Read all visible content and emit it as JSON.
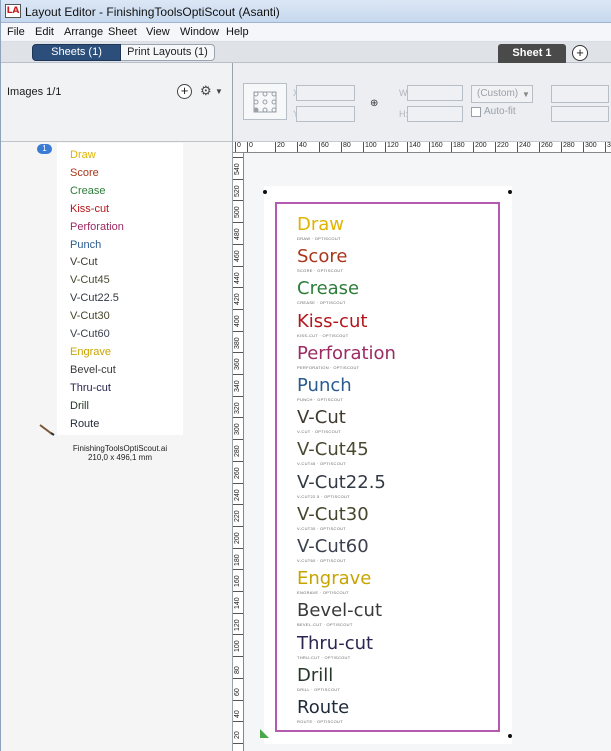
{
  "window": {
    "title": "Layout Editor - FinishingToolsOptiScout (Asanti)",
    "icon_label": "LA"
  },
  "menubar": {
    "items": [
      "File",
      "Edit",
      "Arrange",
      "Sheet",
      "View",
      "Window",
      "Help"
    ]
  },
  "tabs": {
    "sheets": "Sheets (1)",
    "print_layouts": "Print Layouts (1)",
    "sheet_tab": "Sheet 1"
  },
  "left_panel": {
    "images_count": "Images 1/1",
    "badge": "1",
    "file_name": "FinishingToolsOptiScout.ai",
    "file_size": "210,0 x 496,1 mm"
  },
  "toolbar": {
    "x_label": "X:",
    "y_label": "Y:",
    "w_label": "W:",
    "h_label": "H:",
    "preset": "(Custom)",
    "autofit": "Auto-fit"
  },
  "ruler": {
    "top": [
      "0",
      "0",
      "20",
      "40",
      "60",
      "80",
      "100",
      "120",
      "140",
      "160",
      "180",
      "200",
      "220",
      "240",
      "260",
      "280",
      "300",
      "320"
    ],
    "left": [
      "540",
      "520",
      "500",
      "480",
      "460",
      "440",
      "420",
      "400",
      "380",
      "360",
      "340",
      "320",
      "300",
      "280",
      "260",
      "240",
      "220",
      "200",
      "180",
      "160",
      "140",
      "120",
      "100",
      "80",
      "60",
      "40",
      "20",
      "0"
    ]
  },
  "tools": [
    {
      "label": "Draw",
      "color": "#e0b400",
      "sub": "DRAW  ·  OPTISCOUT"
    },
    {
      "label": "Score",
      "color": "#a8361a",
      "sub": "SCORE  ·  OPTISCOUT"
    },
    {
      "label": "Crease",
      "color": "#2e7d3a",
      "sub": "CREASE  ·  OPTISCOUT"
    },
    {
      "label": "Kiss-cut",
      "color": "#b3161b",
      "sub": "KISS-CUT  ·  OPTISCOUT"
    },
    {
      "label": "Perforation",
      "color": "#9c2a63",
      "sub": "PERFORATION  ·  OPTISCOUT"
    },
    {
      "label": "Punch",
      "color": "#2a5a8e",
      "sub": "PUNCH  ·  OPTISCOUT"
    },
    {
      "label": "V-Cut",
      "color": "#3e3a2f",
      "sub": "V-CUT  ·  OPTISCOUT"
    },
    {
      "label": "V-Cut45",
      "color": "#4a4a32",
      "sub": "V-CUT45  ·  OPTISCOUT"
    },
    {
      "label": "V-Cut22.5",
      "color": "#333a44",
      "sub": "V-CUT22.5  ·  OPTISCOUT"
    },
    {
      "label": "V-Cut30",
      "color": "#45462c",
      "sub": "V-CUT30  ·  OPTISCOUT"
    },
    {
      "label": "V-Cut60",
      "color": "#3c4150",
      "sub": "V-CUT60  ·  OPTISCOUT"
    },
    {
      "label": "Engrave",
      "color": "#c8a400",
      "sub": "ENGRAVE  ·  OPTISCOUT"
    },
    {
      "label": "Bevel-cut",
      "color": "#3a3a3a",
      "sub": "BEVEL-CUT  ·  OPTISCOUT"
    },
    {
      "label": "Thru-cut",
      "color": "#2a2650",
      "sub": "THRU-CUT  ·  OPTISCOUT"
    },
    {
      "label": "Drill",
      "color": "#25382a",
      "sub": "DRILL  ·  OPTISCOUT"
    },
    {
      "label": "Route",
      "color": "#1f2a3a",
      "sub": "ROUTE  ·  OPTISCOUT"
    }
  ],
  "colors": {
    "active_tab": "#2c4e7a",
    "art_border": "#b35bb1",
    "sheet_tab": "#4a4a4a",
    "badge": "#3a7bd5"
  }
}
